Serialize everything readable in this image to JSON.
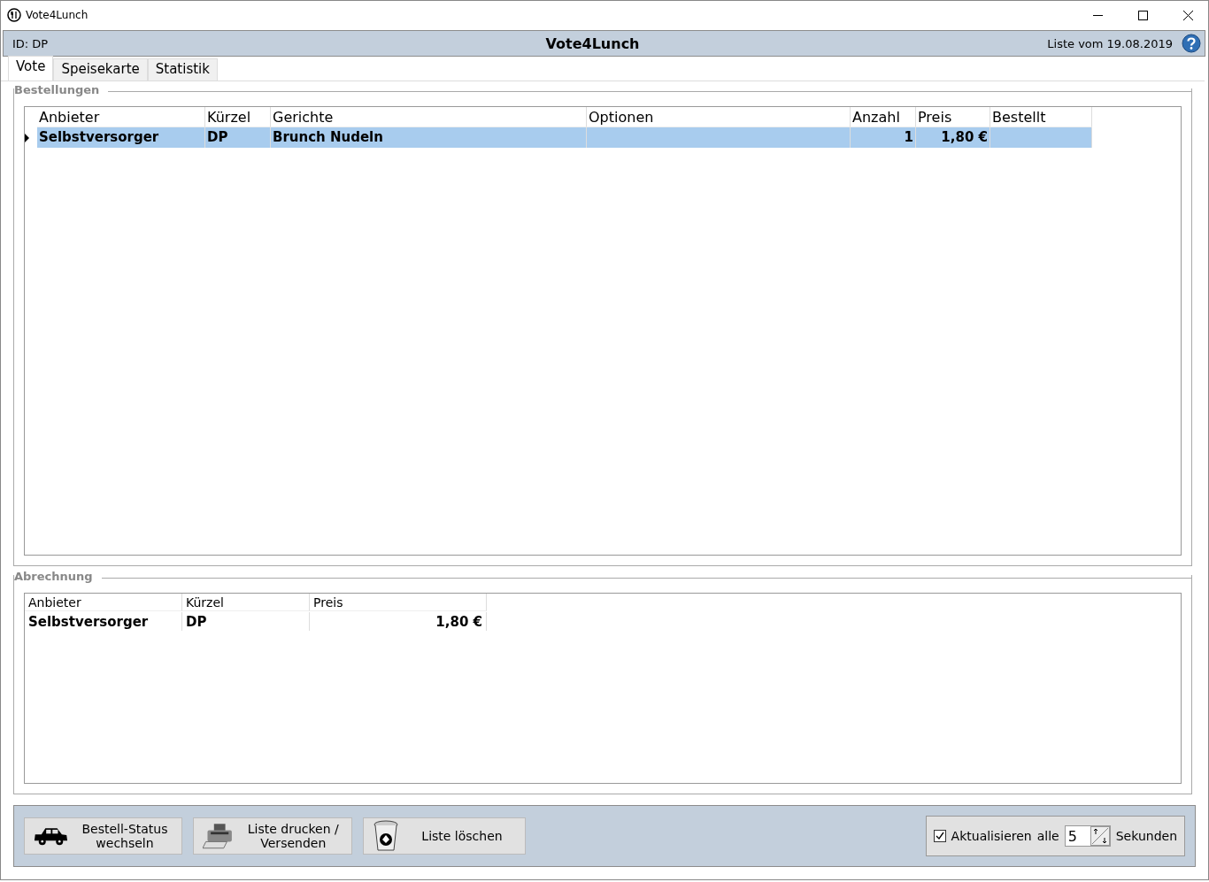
{
  "window": {
    "title": "Vote4Lunch"
  },
  "header": {
    "id_label": "ID: DP",
    "title": "Vote4Lunch",
    "list_date": "Liste vom 19.08.2019"
  },
  "tabs": [
    {
      "label": "Vote",
      "selected": true
    },
    {
      "label": "Speisekarte",
      "selected": false
    },
    {
      "label": "Statistik",
      "selected": false
    }
  ],
  "orders": {
    "title": "Bestellungen",
    "columns": [
      {
        "label": "Anbieter",
        "kind": "text"
      },
      {
        "label": "Kürzel",
        "kind": "text"
      },
      {
        "label": "Gerichte",
        "kind": "text"
      },
      {
        "label": "Optionen",
        "kind": "text"
      },
      {
        "label": "Anzahl",
        "kind": "number"
      },
      {
        "label": "Preis",
        "kind": "number"
      },
      {
        "label": "Bestellt",
        "kind": "text"
      }
    ],
    "rows": [
      {
        "selected": true,
        "cells": [
          "Selbstversorger",
          "DP",
          "Brunch Nudeln",
          "",
          "1",
          "1,80 €",
          ""
        ]
      }
    ]
  },
  "billing": {
    "title": "Abrechnung",
    "columns": [
      {
        "label": "Anbieter",
        "kind": "text"
      },
      {
        "label": "Kürzel",
        "kind": "text"
      },
      {
        "label": "Preis",
        "kind": "number"
      }
    ],
    "rows": [
      {
        "selected": false,
        "cells": [
          "Selbstversorger",
          "DP",
          "1,80 €"
        ]
      }
    ]
  },
  "buttons": [
    {
      "kind": "car",
      "label": "Bestell-Status wechseln"
    },
    {
      "kind": "printer",
      "label": "Liste drucken / Versenden"
    },
    {
      "kind": "trash",
      "label": "Liste löschen"
    }
  ],
  "refresh": {
    "checked": true,
    "label": "Aktualisieren",
    "prefix": "alle",
    "value": "5",
    "suffix": "Sekunden"
  }
}
